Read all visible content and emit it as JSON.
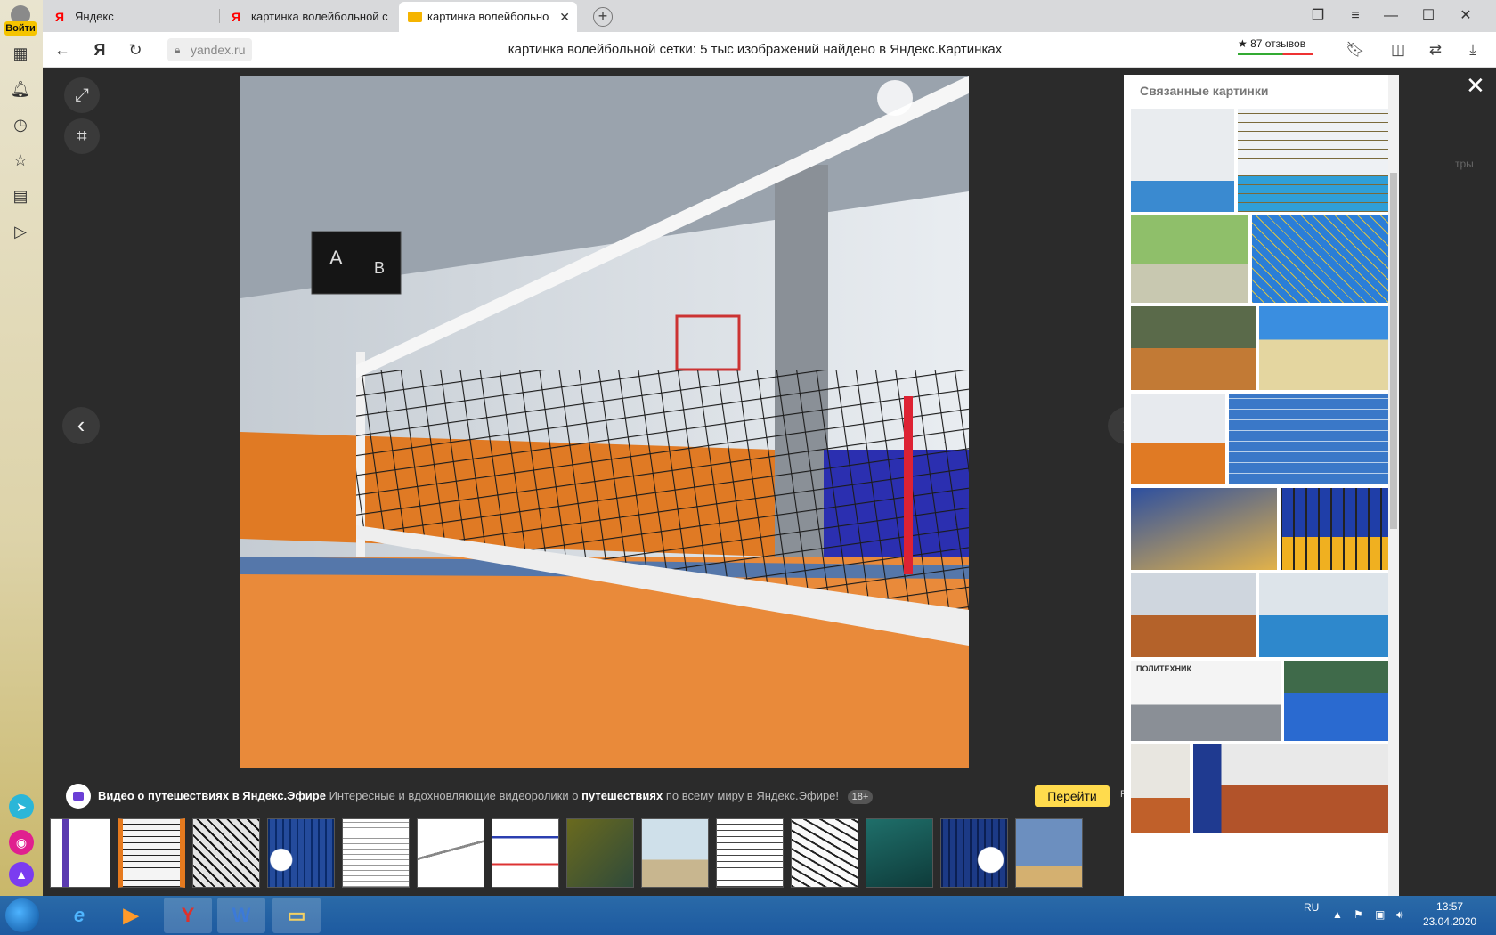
{
  "profile": {
    "login_label": "Войти"
  },
  "tabs": [
    {
      "favicon": "Я",
      "label": "Яндекс"
    },
    {
      "favicon": "Я",
      "label": "картинка волейбольной с"
    },
    {
      "favicon": "image-icon",
      "label": "картинка волейбольно"
    }
  ],
  "address": {
    "domain": "yandex.ru",
    "page_title": "картинка волейбольной сетки: 5 тыс изображений найдено в Яндекс.Картинках",
    "reviews": "★ 87 отзывов"
  },
  "viewer": {
    "related_title": "Связанные картинки",
    "side_hint": "тры"
  },
  "promo": {
    "title": "Видео о путешествиях в Яндекс.Эфире",
    "text_before": " Интересные и вдохновляющие видеоролики о ",
    "text_highlight": "путешествиях",
    "text_after": " по всему миру в Яндекс.Эфире!",
    "age": "18+",
    "button": "Перейти",
    "ad_mark": "Р"
  },
  "related_caption": "ПОЛИТЕХНИК",
  "taskbar": {
    "lang": "RU",
    "time": "13:57",
    "date": "23.04.2020"
  },
  "colors": {
    "accent_yellow": "#ffdb4d",
    "court_orange": "#e98a3a",
    "wall_blue": "#2b2fb0",
    "viewer_bg": "#2b2b2b"
  }
}
